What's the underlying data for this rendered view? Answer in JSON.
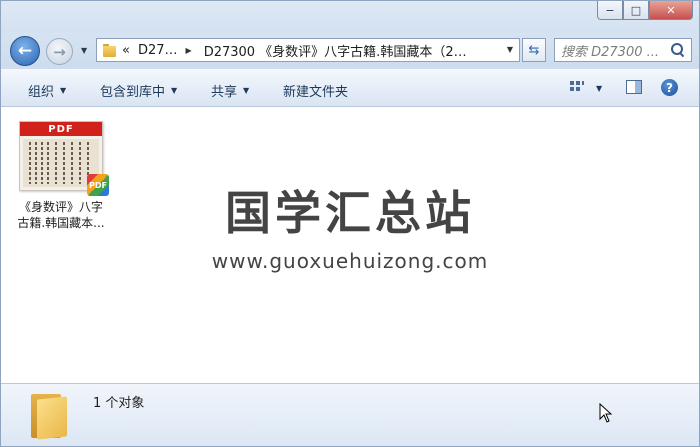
{
  "window": {
    "caption_minimize": "−",
    "caption_maximize": "□",
    "caption_close": "✕"
  },
  "nav": {
    "back_glyph": "←",
    "forward_glyph": "→",
    "address_overflow": "«",
    "address_segment_1": "D27…",
    "address_segment_2": "D27300 《身数评》八字古籍.韩国藏本（2…",
    "search_placeholder": "搜索 D27300 ..."
  },
  "toolbar": {
    "organize": "组织",
    "include_in_library": "包含到库中",
    "share": "共享",
    "new_folder": "新建文件夹",
    "help": "?"
  },
  "content": {
    "file": {
      "type_label": "PDF",
      "badge_label": "PDF",
      "name_line_1": "《身数评》八字",
      "name_line_2": "古籍.韩国藏本..."
    },
    "watermark_cn": "国学汇总站",
    "watermark_url": "www.guoxuehuizong.com"
  },
  "status": {
    "item_count": "1 个对象"
  },
  "icons": {
    "back": "back-arrow-icon",
    "forward": "forward-arrow-icon",
    "folder": "folder-icon",
    "refresh": "refresh-icon",
    "search": "search-icon",
    "view": "view-options-icon",
    "preview_pane": "preview-pane-icon",
    "help": "help-icon",
    "pdf": "pdf-file-icon",
    "cursor": "mouse-cursor-icon"
  }
}
